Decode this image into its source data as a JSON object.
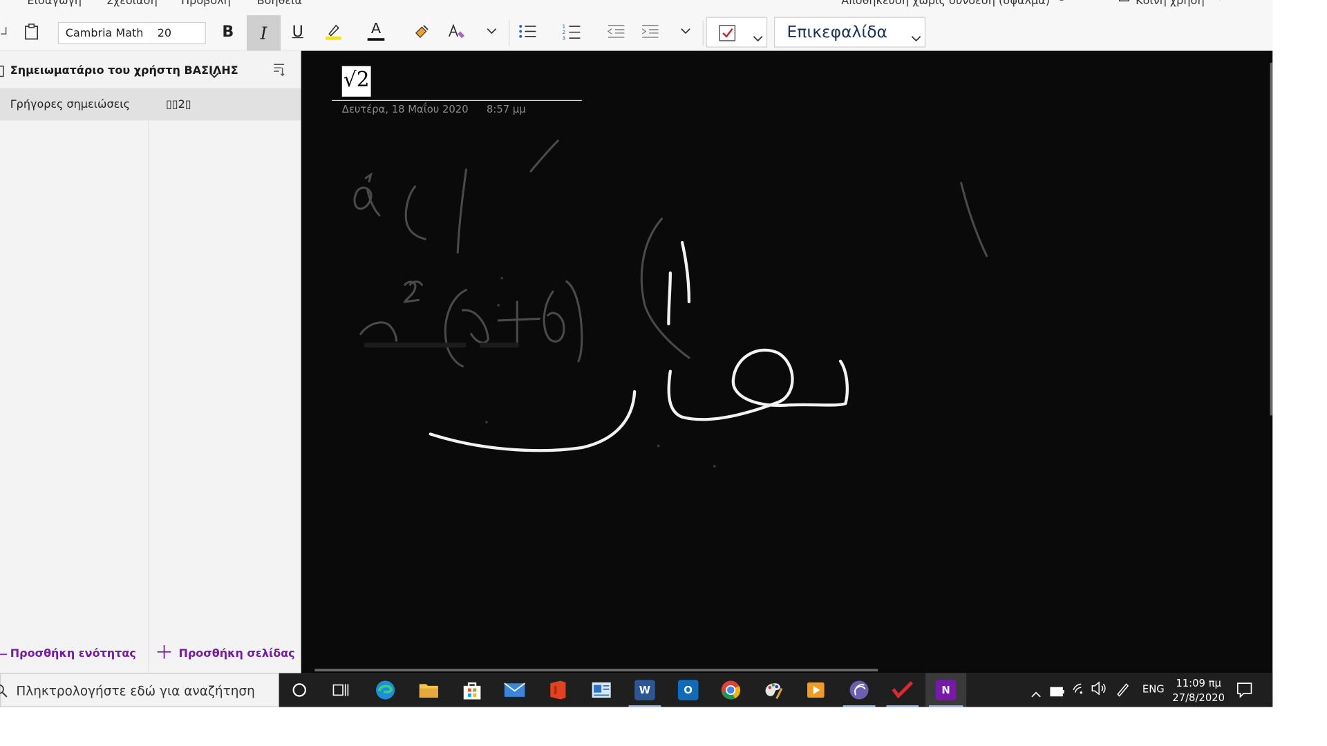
{
  "menu": {
    "items": [
      "Εισαγωγή",
      "Σχεδίαση",
      "Προβολή",
      "Βοήθεια"
    ],
    "status": "Αποθήκευση χωρίς σύνδεση (σφάλμα)",
    "share_label": "Κοινή χρήση"
  },
  "toolbar": {
    "font_name": "Cambria Math",
    "font_size": "20",
    "bold_label": "B",
    "italic_label": "I",
    "underline_label": "U",
    "font_color_label": "A",
    "highlight_color": "#f5e600",
    "font_color": "#111111",
    "style_label": "Επικεφαλίδα"
  },
  "notebook": {
    "title": "Σημειωματάριο του χρήστη ΒΑΣΙΛΗΣ"
  },
  "sections": {
    "items": [
      {
        "label": "Γρήγορες σημειώσεις",
        "selected": true
      }
    ],
    "add_label": "Προσθήκη ενότητας"
  },
  "pages": {
    "items": [
      {
        "label": "▯▯2▯",
        "selected": true
      }
    ],
    "add_label": "Προσθήκη σελίδας"
  },
  "page": {
    "title": "√2",
    "date": "Δευτέρα, 18 Μαΐου 2020",
    "time": "8:57 μμ"
  },
  "taskbar": {
    "search_placeholder": "Πληκτρολογήστε εδώ για αναζήτηση",
    "language": "ENG",
    "time": "11:09 πμ",
    "date": "27/8/2020",
    "accent_color": "#8fb5e8"
  }
}
